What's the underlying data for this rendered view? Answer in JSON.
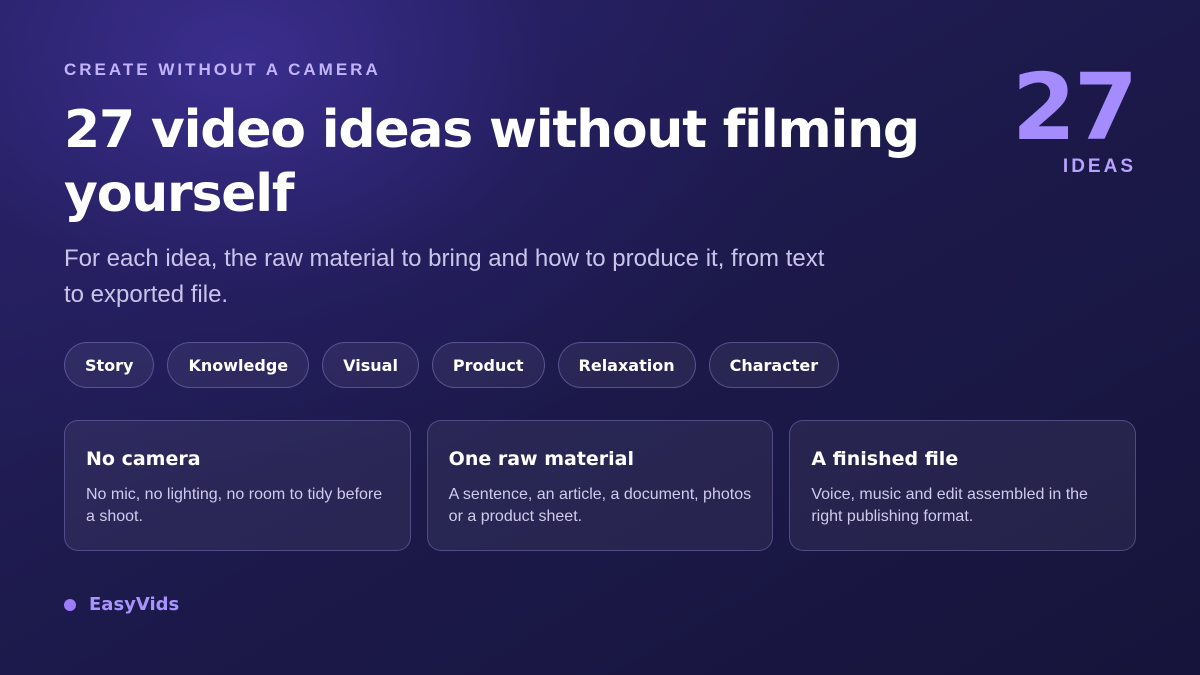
{
  "eyebrow": "CREATE WITHOUT A CAMERA",
  "title": "27 video ideas without filming yourself",
  "subtitle": "For each idea, the raw material to bring and how to produce it, from text to exported file.",
  "counter": {
    "number": "27",
    "label": "IDEAS"
  },
  "tags": [
    {
      "label": "Story"
    },
    {
      "label": "Knowledge"
    },
    {
      "label": "Visual"
    },
    {
      "label": "Product"
    },
    {
      "label": "Relaxation"
    },
    {
      "label": "Character"
    }
  ],
  "cards": [
    {
      "title": "No camera",
      "body": "No mic, no lighting, no room to tidy before a shoot."
    },
    {
      "title": "One raw material",
      "body": "A sentence, an article, a document, photos or a product sheet."
    },
    {
      "title": "A finished file",
      "body": "Voice, music and edit assembled in the right publishing format."
    }
  ],
  "brand": {
    "name": "EasyVids",
    "dot_icon": "dot-icon"
  },
  "colors": {
    "accent": "#a48cff",
    "eyebrow": "#c3b3ff",
    "background": "#1d1a4d"
  }
}
